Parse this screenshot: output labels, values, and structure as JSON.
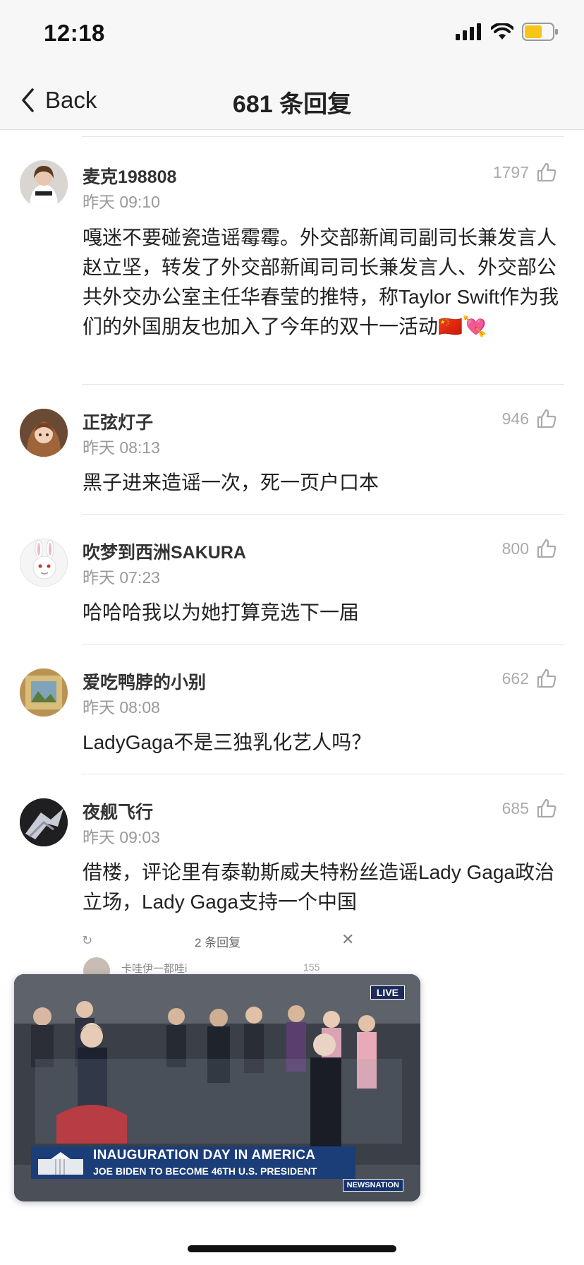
{
  "status_bar": {
    "time": "12:18",
    "icons": [
      "signal-icon",
      "wifi-icon",
      "battery-icon"
    ],
    "battery_color": "#f5c518"
  },
  "nav": {
    "back_label": "Back",
    "title": "681 条回复"
  },
  "comments": [
    {
      "username": "麦克198808",
      "time": "昨天 09:10",
      "likes": "1797",
      "text": "嘎迷不要碰瓷造谣霉霉。外交部新闻司副司长兼发言人赵立坚，转发了外交部新闻司司长兼发言人、外交部公共外交办公室主任华春莹的推特，称Taylor Swift作为我们的外国朋友也加入了今年的双十一活动🇨🇳💘"
    },
    {
      "username": "正弦灯子",
      "time": "昨天 08:13",
      "likes": "946",
      "text": "黑子进来造谣一次，死一页户口本"
    },
    {
      "username": "吹梦到西洲SAKURA",
      "time": "昨天 07:23",
      "likes": "800",
      "text": "哈哈哈我以为她打算竞选下一届"
    },
    {
      "username": "爱吃鸭脖的小别",
      "time": "昨天 08:08",
      "likes": "662",
      "text": "LadyGaga不是三独乳化艺人吗？"
    },
    {
      "username": "夜舰飞行",
      "time": "昨天 09:03",
      "likes": "685",
      "text": "借楼，评论里有泰勒斯威夫特粉丝造谣Lady Gaga政治立场，Lady Gaga支持一个中国"
    }
  ],
  "ghost": {
    "refresh_icon": "↻",
    "title": "2 条回复",
    "close_icon": "✕",
    "username": "卡哇伊一都哇i",
    "likes": "155"
  },
  "video": {
    "live_label": "LIVE",
    "headline": "INAUGURATION DAY IN AMERICA",
    "subhead": "JOE BIDEN TO BECOME 46TH U.S. PRESIDENT",
    "network": "NEWSNATION"
  },
  "colors": {
    "accent_text": "#222222",
    "muted_text": "#999999",
    "nav_bg": "#f7f7f7",
    "news_blue": "#1b3d78"
  }
}
